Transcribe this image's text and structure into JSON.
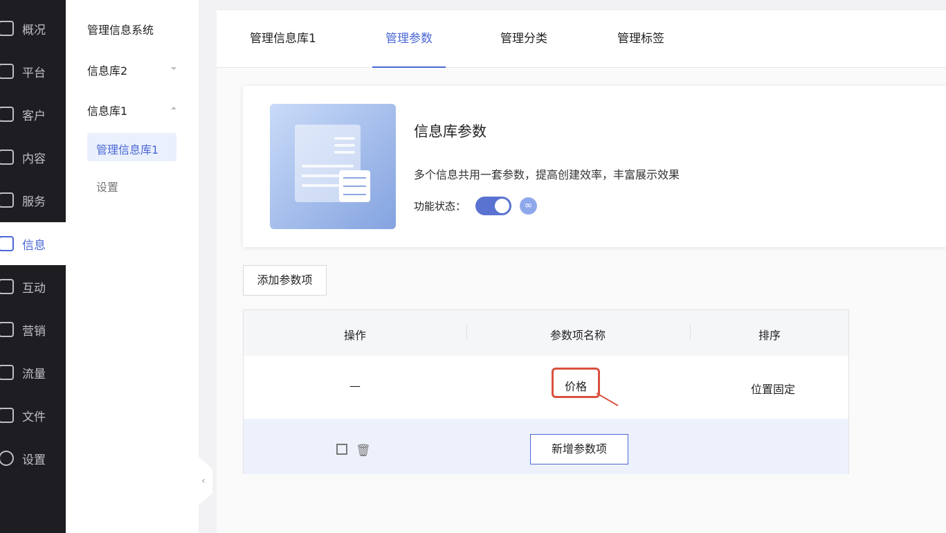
{
  "nav": {
    "items": [
      {
        "label": "概况",
        "icon": "chart-icon"
      },
      {
        "label": "平台",
        "icon": "layers-icon"
      },
      {
        "label": "客户",
        "icon": "user-icon"
      },
      {
        "label": "内容",
        "icon": "document-icon"
      },
      {
        "label": "服务",
        "icon": "service-icon"
      },
      {
        "label": "信息",
        "icon": "message-icon",
        "active": true
      },
      {
        "label": "互动",
        "icon": "interaction-icon"
      },
      {
        "label": "营销",
        "icon": "tag-icon"
      },
      {
        "label": "流量",
        "icon": "megaphone-icon"
      },
      {
        "label": "文件",
        "icon": "folder-icon"
      },
      {
        "label": "设置",
        "icon": "settings-icon"
      }
    ]
  },
  "subnav": {
    "title": "管理信息系统",
    "group2": "信息库2",
    "group1": "信息库1",
    "selected": "管理信息库1",
    "settings": "设置"
  },
  "tabs": [
    "管理信息库1",
    "管理参数",
    "管理分类",
    "管理标签"
  ],
  "active_tab": "管理参数",
  "card": {
    "title": "信息库参数",
    "description": "多个信息共用一套参数，提高创建效率，丰富展示效果",
    "status_label": "功能状态：",
    "status_on": true
  },
  "add_button": "添加参数项",
  "table": {
    "headers": [
      "操作",
      "参数项名称",
      "排序"
    ],
    "rows": [
      {
        "op": "—",
        "name": "价格",
        "order": "位置固定"
      }
    ],
    "new_input": "新增参数项"
  },
  "colors": {
    "accent": "#4a67d6",
    "highlight": "#d9503e"
  }
}
